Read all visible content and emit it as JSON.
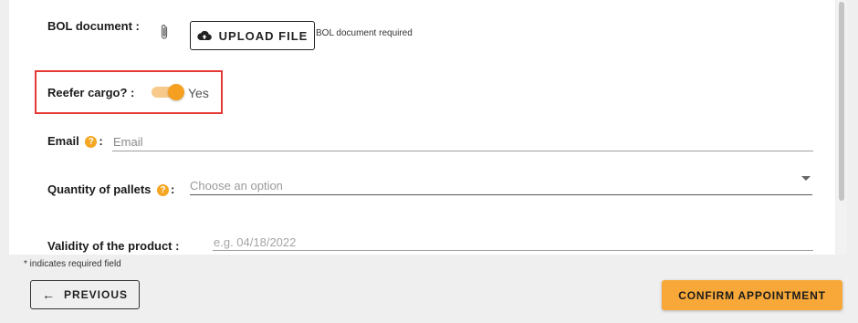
{
  "colors": {
    "accent": "#f7a838",
    "toggle_on": "#f5a020",
    "highlight_border": "#e53935"
  },
  "bol": {
    "label": "BOL document :",
    "icon": "paperclip-icon",
    "upload_icon": "cloud-upload-icon",
    "upload_label": "UPLOAD FILE",
    "note": "BOL document required"
  },
  "reefer": {
    "label": "Reefer cargo? :",
    "toggle_on": true,
    "value_label": "Yes"
  },
  "email": {
    "label": "Email",
    "help_icon": "help-icon",
    "colon": ":",
    "value": "",
    "placeholder": "Email"
  },
  "quantity": {
    "label": "Quantity of pallets",
    "help_icon": "help-icon",
    "colon": ":",
    "placeholder": "Choose an option",
    "icon": "caret-down-icon"
  },
  "validity": {
    "label": "Validity of the product :",
    "value": "",
    "placeholder": "e.g. 04/18/2022"
  },
  "footer": {
    "required_note": "* indicates required field",
    "previous_icon": "arrow-left-icon",
    "previous_label": "PREVIOUS",
    "confirm_label": "CONFIRM APPOINTMENT"
  }
}
